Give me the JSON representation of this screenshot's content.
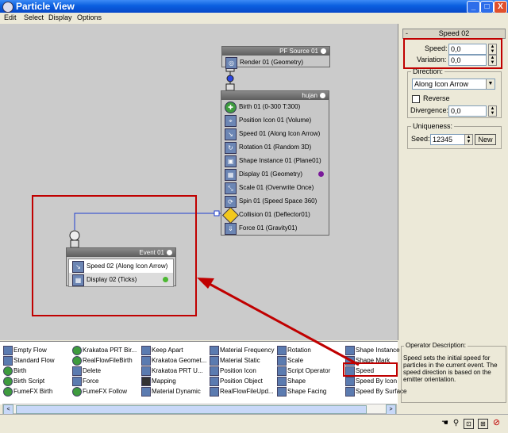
{
  "window": {
    "title": "Particle View",
    "minimize": "_",
    "maximize": "□",
    "close": "X"
  },
  "menu": [
    "Edit",
    "Select",
    "Display",
    "Options"
  ],
  "nodes": {
    "pf_source": {
      "title": "PF Source 01",
      "ops": [
        "Render 01 (Geometry)"
      ]
    },
    "hujan": {
      "title": "hujan",
      "ops": [
        "Birth 01 (0-300 T:300)",
        "Position Icon 01 (Volume)",
        "Speed 01 (Along Icon Arrow)",
        "Rotation 01 (Random 3D)",
        "Shape Instance 01 (Plane01)",
        "Display 01 (Geometry)",
        "Scale 01 (Overwrite Once)",
        "Spin 01 (Speed Space 360)",
        "Collision 01 (Deflector01)",
        "Force 01 (Gravity01)"
      ],
      "display_dot_color": "#7A1A9A"
    },
    "event": {
      "title": "Event 01",
      "ops": [
        "Speed 02 (Along Icon Arrow)",
        "Display 02 (Ticks)"
      ],
      "display_dot_color": "#4CB832"
    }
  },
  "rollout": {
    "minus": "-",
    "title": "Speed 02",
    "speed_label": "Speed:",
    "speed_value": "0,0",
    "variation_label": "Variation:",
    "variation_value": "0,0",
    "direction_group": "Direction:",
    "direction_value": "Along Icon Arrow",
    "reverse_label": "Reverse",
    "divergence_label": "Divergence:",
    "divergence_value": "0,0",
    "uniqueness_group": "Uniqueness:",
    "seed_label": "Seed:",
    "seed_value": "12345",
    "new_button": "New"
  },
  "depot": [
    [
      "Empty Flow",
      "Standard Flow",
      "Birth",
      "Birth Script",
      "FumeFX Birth"
    ],
    [
      "Krakatoa PRT Bir...",
      "RealFlowFileBirth",
      "Delete",
      "Force",
      "FumeFX Follow"
    ],
    [
      "Keep Apart",
      "Krakatoa Geomet...",
      "Krakatoa PRT U...",
      "Mapping",
      "Material Dynamic"
    ],
    [
      "Material Frequency",
      "Material Static",
      "Position Icon",
      "Position Object",
      "RealFlowFileUpd..."
    ],
    [
      "Rotation",
      "Scale",
      "Script Operator",
      "Shape",
      "Shape Facing"
    ],
    [
      "Shape Instance",
      "Shape Mark",
      "Speed",
      "Speed By Icon",
      "Speed By Surface"
    ]
  ],
  "description": {
    "caption": "Operator Description:",
    "text": "Speed sets the initial speed for particles in the current event.  The speed direction is based on the emitter orientation."
  },
  "scrollbar": {
    "left": "<",
    "right": ">"
  },
  "status_icons": [
    "hand-icon",
    "zoom-icon",
    "zoom-region-icon",
    "zoom-extents-icon",
    "no-entry-icon"
  ],
  "colors": {
    "annotation_red": "#C00000",
    "wire_blue": "#1F3FCF",
    "title_blue": "#0A5FE0"
  }
}
